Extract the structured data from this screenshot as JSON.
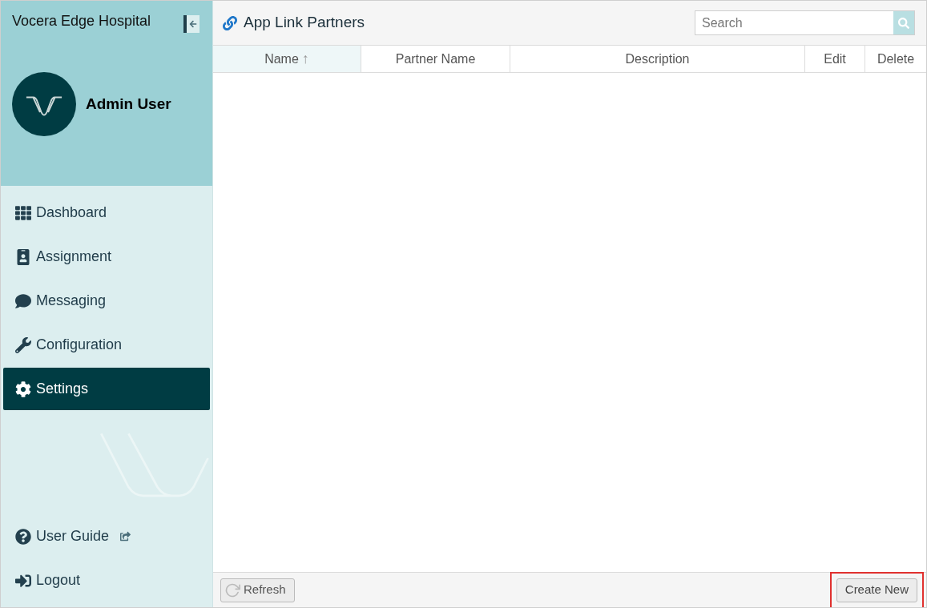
{
  "sidebar": {
    "hospital": "Vocera Edge Hospital",
    "user": "Admin User",
    "nav": [
      {
        "label": "Dashboard",
        "selected": false
      },
      {
        "label": "Assignment",
        "selected": false
      },
      {
        "label": "Messaging",
        "selected": false
      },
      {
        "label": "Configuration",
        "selected": false
      },
      {
        "label": "Settings",
        "selected": true
      }
    ],
    "footer_links": [
      {
        "label": "User Guide",
        "external": true
      },
      {
        "label": "Logout",
        "external": false
      }
    ]
  },
  "page": {
    "title": "App Link Partners",
    "search": {
      "placeholder": "Search"
    }
  },
  "table": {
    "columns": [
      {
        "label": "Name",
        "sorted": true,
        "sort_mark": "↑"
      },
      {
        "label": "Partner Name",
        "sorted": false
      },
      {
        "label": "Description",
        "sorted": false
      },
      {
        "label": "Edit",
        "sorted": false
      },
      {
        "label": "Delete",
        "sorted": false
      }
    ]
  },
  "footer": {
    "refresh": {
      "label": "Refresh",
      "disabled": true
    },
    "create": {
      "label": "Create New",
      "highlighted": true
    }
  }
}
